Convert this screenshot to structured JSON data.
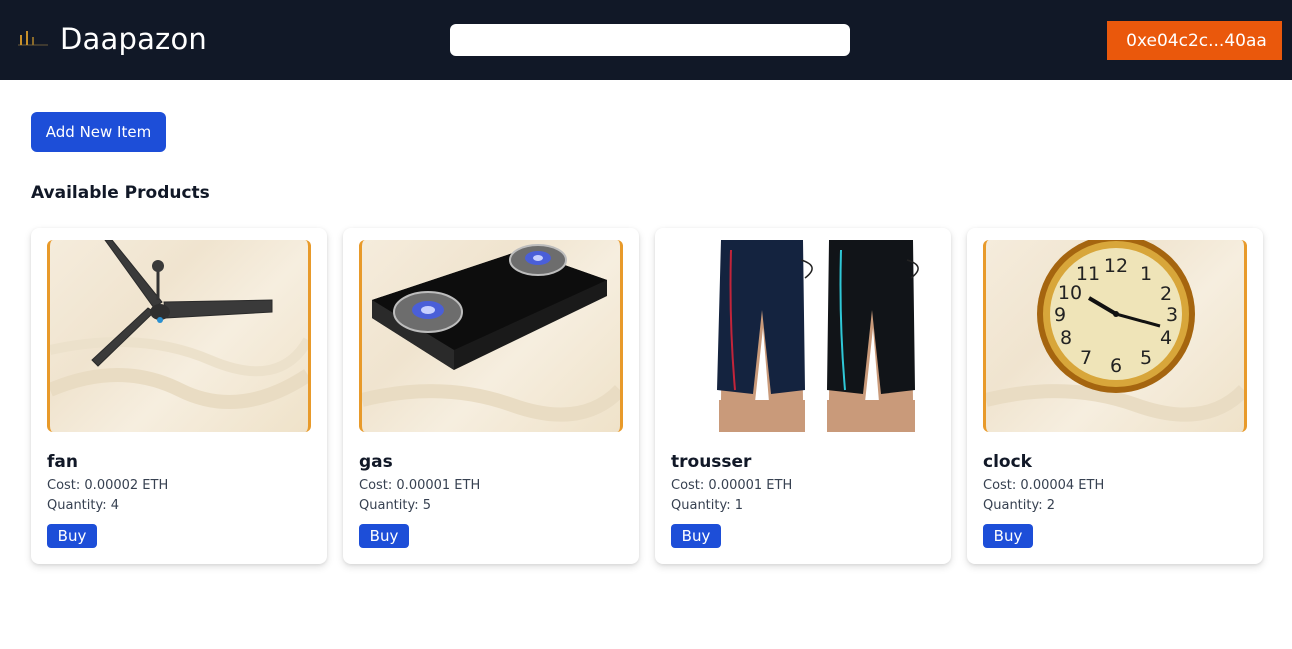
{
  "navbar": {
    "logo_icon": "store-logo-icon",
    "brand": "Daapazon",
    "search": {
      "value": "",
      "placeholder": ""
    },
    "wallet_address": "0xe04c2c...40aa"
  },
  "main": {
    "add_button_label": "Add New Item",
    "section_title": "Available Products",
    "products": [
      {
        "name": "fan",
        "cost": "Cost: 0.00002 ETH",
        "quantity": "Quantity: 4",
        "buy_label": "Buy",
        "image": "ceiling-fan-image"
      },
      {
        "name": "gas",
        "cost": "Cost: 0.00001 ETH",
        "quantity": "Quantity: 5",
        "buy_label": "Buy",
        "image": "gas-stove-image"
      },
      {
        "name": "trousser",
        "cost": "Cost: 0.00001 ETH",
        "quantity": "Quantity: 1",
        "buy_label": "Buy",
        "image": "shorts-image"
      },
      {
        "name": "clock",
        "cost": "Cost: 0.00004 ETH",
        "quantity": "Quantity: 2",
        "buy_label": "Buy",
        "image": "wall-clock-image"
      }
    ]
  },
  "colors": {
    "navbar_bg": "#111827",
    "wallet_bg": "#ea580c",
    "primary_button": "#1d4ed8",
    "image_frame": "#e89a2a"
  }
}
